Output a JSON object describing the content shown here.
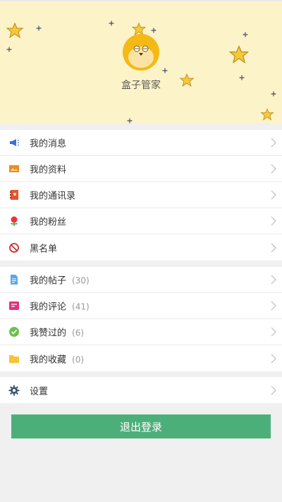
{
  "profile": {
    "username": "盒子管家"
  },
  "menu_group_1": {
    "items": [
      {
        "label": "我的消息",
        "icon": "megaphone-icon"
      },
      {
        "label": "我的资料",
        "icon": "picture-icon"
      },
      {
        "label": "我的通讯录",
        "icon": "contacts-book-icon"
      },
      {
        "label": "我的粉丝",
        "icon": "flower-icon"
      },
      {
        "label": "黑名单",
        "icon": "blocked-icon"
      }
    ]
  },
  "menu_group_2": {
    "items": [
      {
        "label": "我的帖子",
        "count": "(30)",
        "icon": "document-icon"
      },
      {
        "label": "我的评论",
        "count": "(41)",
        "icon": "comment-icon"
      },
      {
        "label": "我赞过的",
        "count": "(6)",
        "icon": "check-circle-icon"
      },
      {
        "label": "我的收藏",
        "count": "(0)",
        "icon": "folder-icon"
      }
    ]
  },
  "menu_group_3": {
    "items": [
      {
        "label": "设置",
        "icon": "gear-icon"
      }
    ]
  },
  "logout_button": {
    "label": "退出登录"
  },
  "colors": {
    "header_bg": "#fdf3c8",
    "accent_green": "#4caf7a",
    "star_yellow": "#f6c83a"
  }
}
